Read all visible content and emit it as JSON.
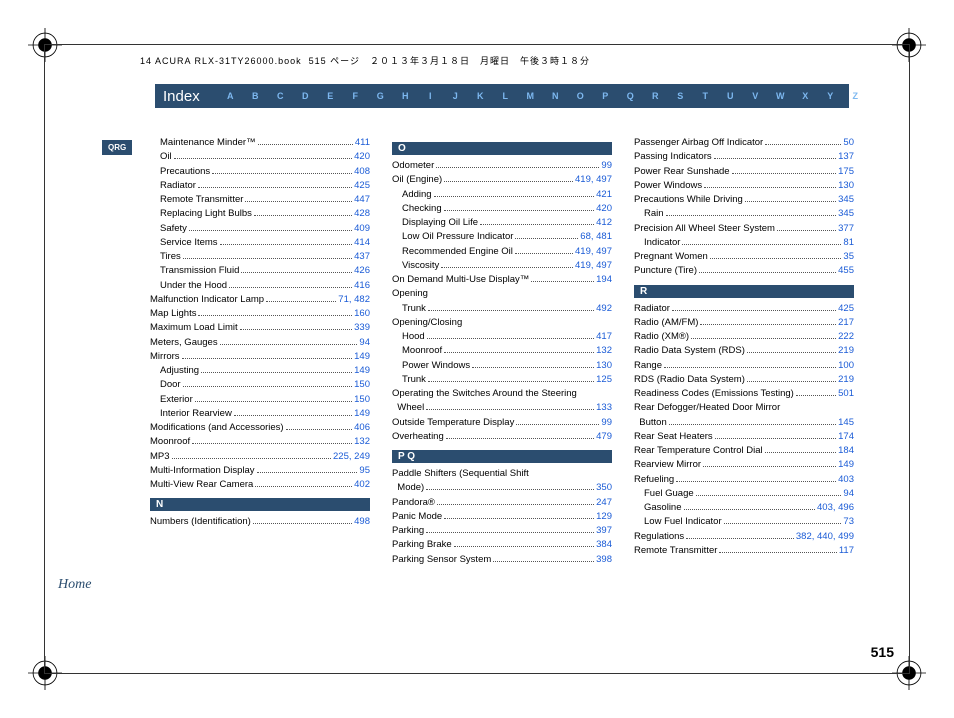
{
  "meta": {
    "book": "14 ACURA RLX-31TY26000.book",
    "pageinfo": "515 ページ　２０１３年３月１８日　月曜日　午後３時１８分"
  },
  "header": {
    "title": "Index",
    "letters": [
      "A",
      "B",
      "C",
      "D",
      "E",
      "F",
      "G",
      "H",
      "I",
      "J",
      "K",
      "L",
      "M",
      "N",
      "O",
      "P",
      "Q",
      "R",
      "S",
      "T",
      "U",
      "V",
      "W",
      "X",
      "Y",
      "Z"
    ]
  },
  "side_tab": "QRG",
  "home": "Home",
  "page_number": "515",
  "columns": [
    {
      "sections": [
        {
          "head": null,
          "entries": [
            {
              "label": "Maintenance Minder™",
              "pages": "411",
              "sub": true
            },
            {
              "label": "Oil",
              "pages": "420",
              "sub": true
            },
            {
              "label": "Precautions",
              "pages": "408",
              "sub": true
            },
            {
              "label": "Radiator",
              "pages": "425",
              "sub": true
            },
            {
              "label": "Remote Transmitter",
              "pages": "447",
              "sub": true
            },
            {
              "label": "Replacing Light Bulbs",
              "pages": "428",
              "sub": true
            },
            {
              "label": "Safety",
              "pages": "409",
              "sub": true
            },
            {
              "label": "Service Items",
              "pages": "414",
              "sub": true
            },
            {
              "label": "Tires",
              "pages": "437",
              "sub": true
            },
            {
              "label": "Transmission Fluid",
              "pages": "426",
              "sub": true
            },
            {
              "label": "Under the Hood",
              "pages": "416",
              "sub": true
            },
            {
              "label": "Malfunction Indicator Lamp",
              "pages": "71, 482"
            },
            {
              "label": "Map Lights",
              "pages": "160"
            },
            {
              "label": "Maximum Load Limit",
              "pages": "339"
            },
            {
              "label": "Meters, Gauges",
              "pages": "94"
            },
            {
              "label": "Mirrors",
              "pages": "149"
            },
            {
              "label": "Adjusting",
              "pages": "149",
              "sub": true
            },
            {
              "label": "Door",
              "pages": "150",
              "sub": true
            },
            {
              "label": "Exterior",
              "pages": "150",
              "sub": true
            },
            {
              "label": "Interior Rearview",
              "pages": "149",
              "sub": true
            },
            {
              "label": "Modifications (and Accessories)",
              "pages": "406"
            },
            {
              "label": "Moonroof",
              "pages": "132"
            },
            {
              "label": "MP3",
              "pages": "225, 249"
            },
            {
              "label": "Multi-Information Display",
              "pages": "95"
            },
            {
              "label": "Multi-View Rear Camera",
              "pages": "402"
            }
          ]
        },
        {
          "head": "N",
          "entries": [
            {
              "label": "Numbers (Identification)",
              "pages": "498"
            }
          ]
        }
      ]
    },
    {
      "sections": [
        {
          "head": "O",
          "entries": [
            {
              "label": "Odometer",
              "pages": "99"
            },
            {
              "label": "Oil (Engine)",
              "pages": "419, 497"
            },
            {
              "label": "Adding",
              "pages": "421",
              "sub": true
            },
            {
              "label": "Checking",
              "pages": "420",
              "sub": true
            },
            {
              "label": "Displaying Oil Life",
              "pages": "412",
              "sub": true
            },
            {
              "label": "Low Oil Pressure Indicator",
              "pages": "68, 481",
              "sub": true
            },
            {
              "label": "Recommended Engine Oil",
              "pages": "419, 497",
              "sub": true
            },
            {
              "label": "Viscosity",
              "pages": "419, 497",
              "sub": true
            },
            {
              "label": "On Demand Multi-Use Display™",
              "pages": "194"
            },
            {
              "label": "Opening",
              "pages": ""
            },
            {
              "label": "Trunk",
              "pages": "492",
              "sub": true
            },
            {
              "label": "Opening/Closing",
              "pages": ""
            },
            {
              "label": "Hood",
              "pages": "417",
              "sub": true
            },
            {
              "label": "Moonroof",
              "pages": "132",
              "sub": true
            },
            {
              "label": "Power Windows",
              "pages": "130",
              "sub": true
            },
            {
              "label": "Trunk",
              "pages": "125",
              "sub": true
            },
            {
              "label": "Operating the Switches Around the Steering",
              "wrap": true,
              "cont": "Wheel",
              "pages": "133"
            },
            {
              "label": "Outside Temperature Display",
              "pages": "99"
            },
            {
              "label": "Overheating",
              "pages": "479"
            }
          ]
        },
        {
          "head": "P  Q",
          "entries": [
            {
              "label": "Paddle Shifters (Sequential Shift",
              "wrap": true,
              "cont": "Mode)",
              "pages": "350"
            },
            {
              "label": "Pandora®",
              "pages": "247"
            },
            {
              "label": "Panic Mode",
              "pages": "129"
            },
            {
              "label": "Parking",
              "pages": "397"
            },
            {
              "label": "Parking Brake",
              "pages": "384"
            },
            {
              "label": "Parking Sensor System",
              "pages": "398"
            }
          ]
        }
      ]
    },
    {
      "sections": [
        {
          "head": null,
          "entries": [
            {
              "label": "Passenger Airbag Off Indicator",
              "pages": "50"
            },
            {
              "label": "Passing Indicators",
              "pages": "137"
            },
            {
              "label": "Power Rear Sunshade",
              "pages": "175"
            },
            {
              "label": "Power Windows",
              "pages": "130"
            },
            {
              "label": "Precautions While Driving",
              "pages": "345"
            },
            {
              "label": "Rain",
              "pages": "345",
              "sub": true
            },
            {
              "label": "Precision All Wheel Steer System",
              "pages": "377"
            },
            {
              "label": "Indicator",
              "pages": "81",
              "sub": true
            },
            {
              "label": "Pregnant Women",
              "pages": "35"
            },
            {
              "label": "Puncture (Tire)",
              "pages": "455"
            }
          ]
        },
        {
          "head": "R",
          "entries": [
            {
              "label": "Radiator",
              "pages": "425"
            },
            {
              "label": "Radio (AM/FM)",
              "pages": "217"
            },
            {
              "label": "Radio (XM®)",
              "pages": "222"
            },
            {
              "label": "Radio Data System (RDS)",
              "pages": "219"
            },
            {
              "label": "Range",
              "pages": "100"
            },
            {
              "label": "RDS (Radio Data System)",
              "pages": "219"
            },
            {
              "label": "Readiness Codes (Emissions Testing)",
              "pages": "501"
            },
            {
              "label": "Rear Defogger/Heated Door Mirror",
              "wrap": true,
              "cont": "Button",
              "pages": "145"
            },
            {
              "label": "Rear Seat Heaters",
              "pages": "174"
            },
            {
              "label": "Rear Temperature Control Dial",
              "pages": "184"
            },
            {
              "label": "Rearview Mirror",
              "pages": "149"
            },
            {
              "label": "Refueling",
              "pages": "403"
            },
            {
              "label": "Fuel Guage",
              "pages": "94",
              "sub": true
            },
            {
              "label": "Gasoline",
              "pages": "403, 496",
              "sub": true
            },
            {
              "label": "Low Fuel Indicator",
              "pages": "73",
              "sub": true
            },
            {
              "label": "Regulations",
              "pages": "382, 440, 499"
            },
            {
              "label": "Remote Transmitter",
              "pages": "117"
            }
          ]
        }
      ]
    }
  ]
}
